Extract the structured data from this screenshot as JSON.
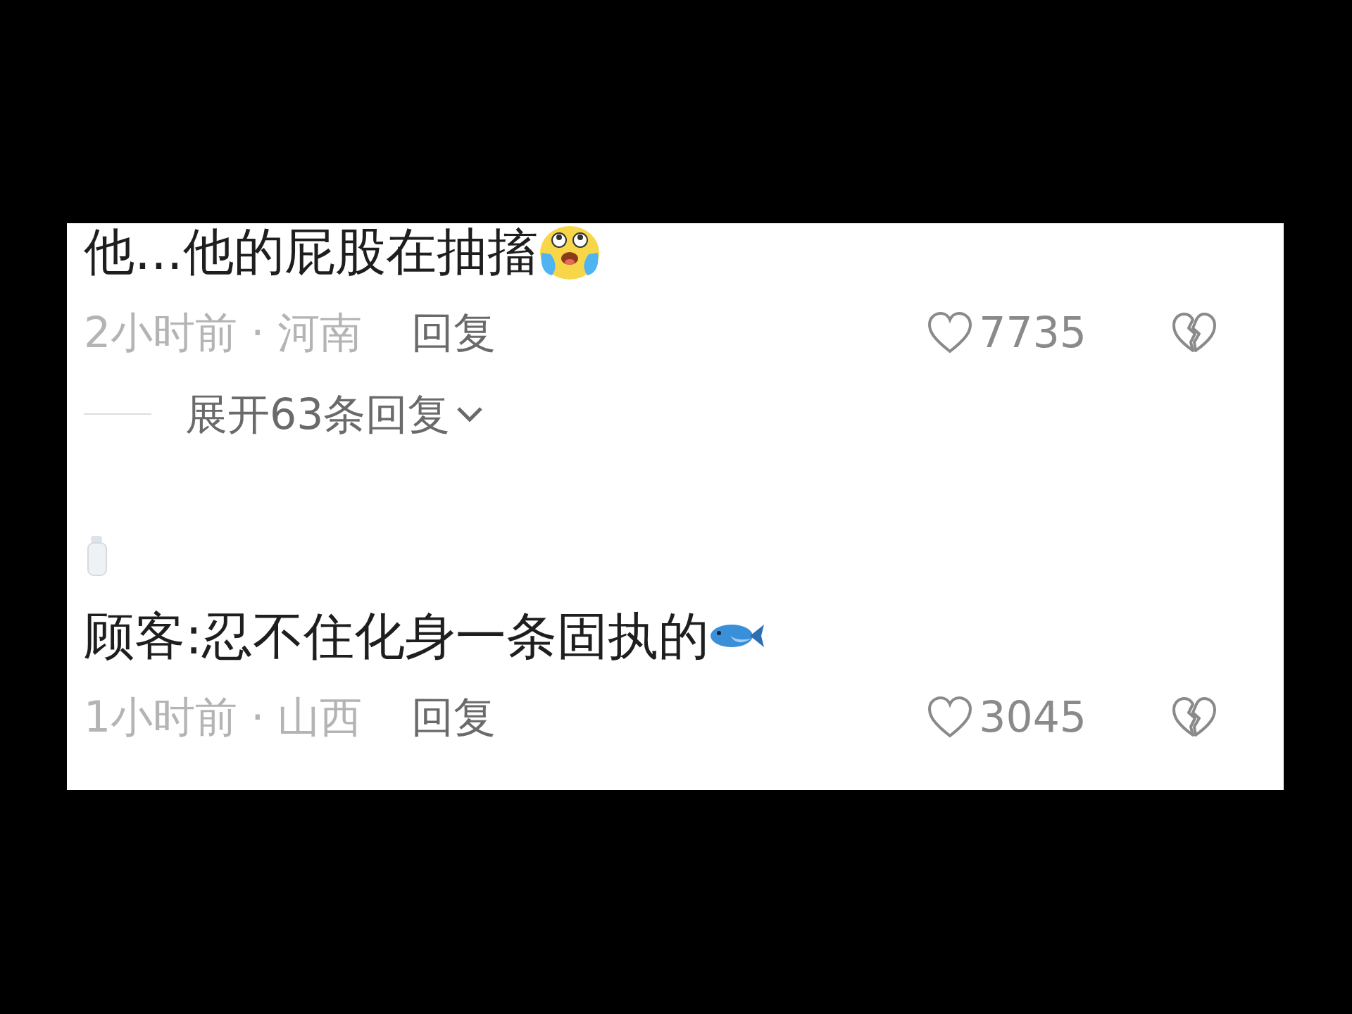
{
  "comments": [
    {
      "kind": "cut-off",
      "text": "他...他的屁股在抽搐",
      "emoji": {
        "kind": "crying-face"
      },
      "meta": "2小时前 · 河南",
      "reply": "回复",
      "likes": "7735",
      "expand": "展开63条回复"
    },
    {
      "kind": "full",
      "text": "顾客:忍不住化身一条固执的",
      "emoji": {
        "kind": "fish"
      },
      "meta": "1小时前 · 山西",
      "reply": "回复",
      "likes": "3045"
    }
  ]
}
